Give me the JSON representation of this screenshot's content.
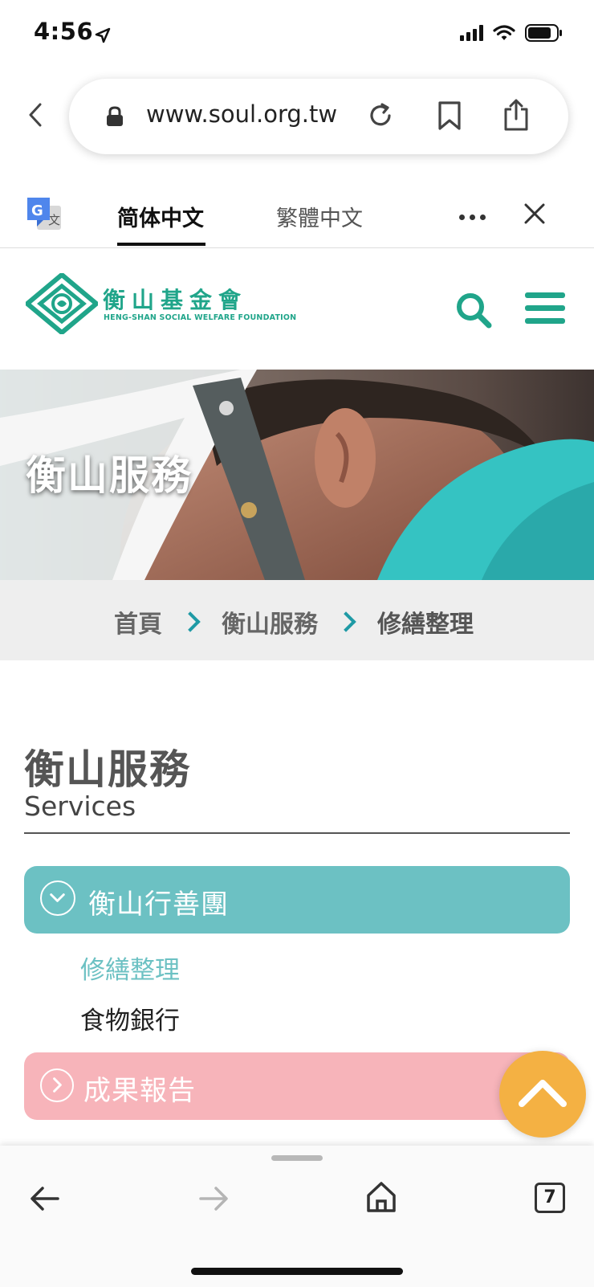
{
  "status_bar": {
    "time": "4:56"
  },
  "browser": {
    "url": "www.soul.org.tw",
    "icons": [
      "back-chevron-icon",
      "lock-icon",
      "reload-icon",
      "bookmark-icon",
      "share-icon"
    ]
  },
  "translate_bar": {
    "tab_simplified": "简体中文",
    "tab_traditional": "繁體中文"
  },
  "site_header": {
    "logo_cn": "衡山基金會",
    "logo_en": "HENG-SHAN SOCIAL WELFARE FOUNDATION",
    "accent_color": "#20a58a"
  },
  "hero": {
    "title": "衡山服務"
  },
  "breadcrumb": {
    "items": [
      "首頁",
      "衡山服務",
      "修繕整理"
    ],
    "separator_color": "#1f9aa5"
  },
  "section": {
    "title": "衡山服務",
    "subtitle": "Services"
  },
  "accordion": {
    "group1": {
      "label": "衡山行善團",
      "color": "#6cc1c3",
      "items": [
        "修繕整理",
        "食物銀行"
      ]
    },
    "group2": {
      "label": "成果報告",
      "color": "#f7b4ba"
    }
  },
  "scroll_top_color": "#f4b143",
  "toolbar": {
    "tab_count": "7"
  }
}
